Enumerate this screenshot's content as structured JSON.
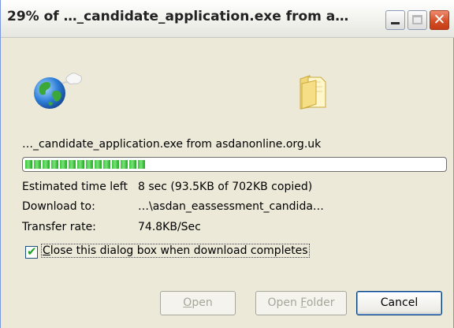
{
  "window": {
    "title": "29% of …_candidate_application.exe from a…"
  },
  "titlebar_buttons": {
    "minimize_icon": "minimize-icon",
    "maximize_icon": "maximize-icon",
    "close_icon": "close-icon",
    "close_glyph": "✕"
  },
  "icons": {
    "globe": "globe-icon",
    "folder": "folder-icon"
  },
  "download": {
    "source_line": "…_candidate_application.exe from asdanonline.org.uk",
    "progress_fraction": 0.29,
    "time_left_label": "Estimated time left",
    "time_left_value": "8 sec (93.5KB of 702KB copied)",
    "download_to_label": "Download to:",
    "download_to_value": "…\\asdan_eassessment_candida…",
    "transfer_rate_label": "Transfer rate:",
    "transfer_rate_value": "74.8KB/Sec"
  },
  "options": {
    "close_on_complete_checked": true,
    "close_on_complete_prefix": "C",
    "close_on_complete_rest": "lose this dialog box when download completes"
  },
  "buttons": {
    "open_underlined": "O",
    "open_rest": "pen",
    "open_folder_prefix": "Open ",
    "open_folder_underlined": "F",
    "open_folder_rest": "older",
    "cancel": "Cancel"
  },
  "colors": {
    "progress_green": "#3ac63a",
    "close_button_red": "#d24c24"
  }
}
